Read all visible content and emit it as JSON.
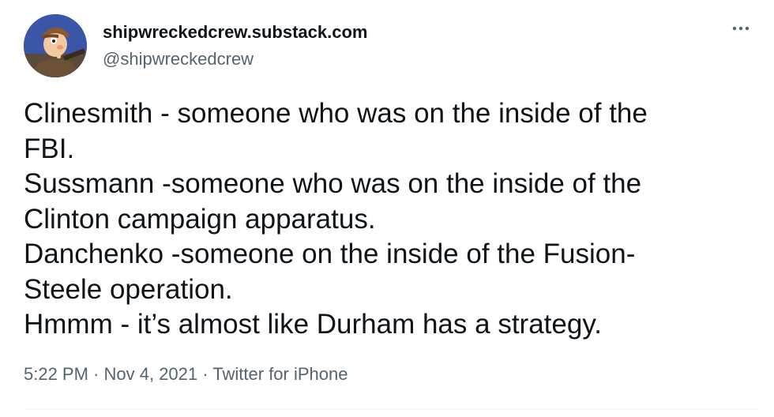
{
  "tweet": {
    "display_name": "shipwreckedcrew.substack.com",
    "handle": "@shipwreckedcrew",
    "avatar_icon": "cartoon-hunter-avatar",
    "more_icon": "more-horizontal-icon",
    "text_lines": [
      "Clinesmith - someone who was on the inside of the",
      "FBI.",
      "Sussmann -someone who was on the inside of the",
      "Clinton campaign apparatus.",
      "Danchenko -someone on the inside of the Fusion-",
      "Steele operation.",
      "Hmmm - it’s almost like Durham has a strategy."
    ],
    "time": "5:22 PM",
    "separator": " · ",
    "date": "Nov 4, 2021",
    "source": "Twitter for iPhone"
  },
  "colors": {
    "text": "#0f1419",
    "secondary_text": "#536471",
    "divider": "#eff3f4"
  }
}
